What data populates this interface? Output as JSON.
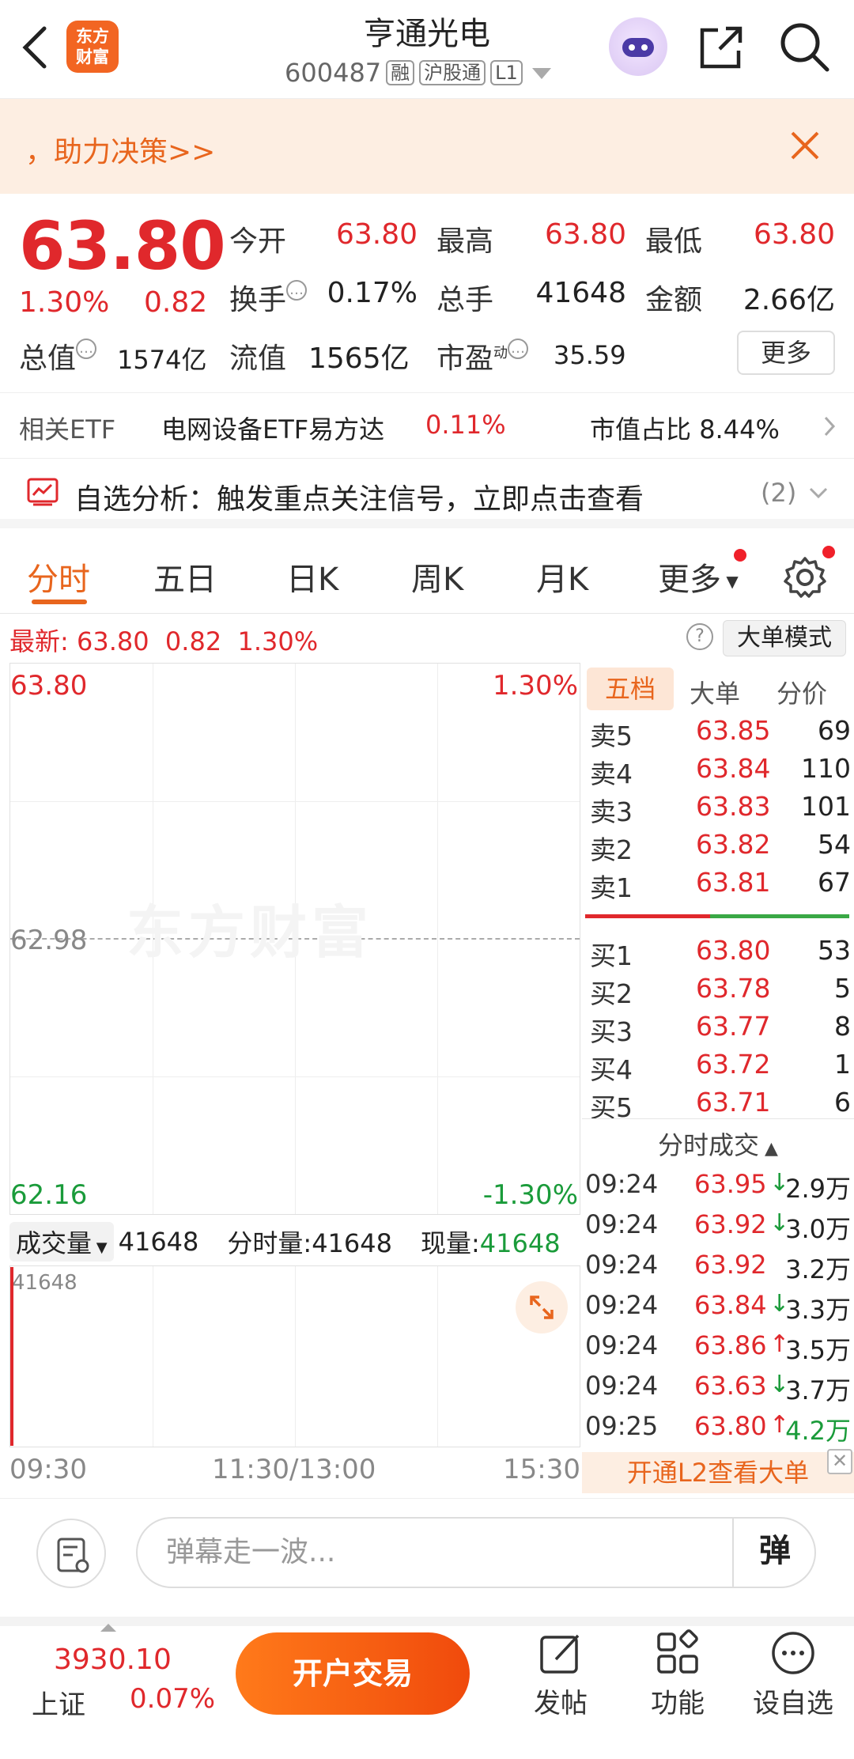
{
  "header": {
    "title": "亨通光电",
    "code": "600487",
    "tags": [
      "融",
      "沪股通",
      "L1"
    ],
    "logo_text_line1": "东方",
    "logo_text_line2": "财富"
  },
  "banner": {
    "text": "，助力决策>>"
  },
  "quote": {
    "price": "63.80",
    "change_pct": "1.30%",
    "change": "0.82",
    "fields": {
      "open_label": "今开",
      "open": "63.80",
      "high_label": "最高",
      "high": "63.80",
      "low_label": "最低",
      "low": "63.80",
      "turnover_label": "换手",
      "turnover": "0.17%",
      "volume_label": "总手",
      "volume": "41648",
      "amount_label": "金额",
      "amount": "2.66亿",
      "mktcap_label": "总值",
      "mktcap": "1574亿",
      "float_label": "流值",
      "float": "1565亿",
      "pe_label": "市盈",
      "pe_sup": "动",
      "pe": "35.59"
    },
    "more_label": "更多"
  },
  "etf": {
    "label": "相关ETF",
    "name": "电网设备ETF易方达",
    "pct": "0.11%",
    "ratio_label": "市值占比",
    "ratio": "8.44%"
  },
  "analysis": {
    "text": "自选分析：触发重点关注信号，立即点击查看",
    "count": "(2)"
  },
  "tabs": [
    "分时",
    "五日",
    "日K",
    "周K",
    "月K",
    "更多"
  ],
  "latest": {
    "label": "最新:",
    "price": "63.80",
    "change": "0.82",
    "pct": "1.30%",
    "mode_label": "大单模式"
  },
  "chart": {
    "top_price": "63.80",
    "top_pct": "1.30%",
    "mid_price": "62.98",
    "bottom_price": "62.16",
    "bottom_pct": "-1.30%",
    "watermark": "东方财富",
    "time_labels": [
      "09:30",
      "11:30/13:00",
      "15:30"
    ]
  },
  "volume": {
    "select_label": "成交量",
    "total": "41648",
    "fs_label": "分时量:",
    "fs": "41648",
    "now_label": "现量:",
    "now": "41648",
    "max_label": "41648"
  },
  "orderbook": {
    "tabs": [
      "五档",
      "大单",
      "分价"
    ],
    "asks": [
      {
        "label": "卖5",
        "price": "63.85",
        "vol": "69"
      },
      {
        "label": "卖4",
        "price": "63.84",
        "vol": "110"
      },
      {
        "label": "卖3",
        "price": "63.83",
        "vol": "101"
      },
      {
        "label": "卖2",
        "price": "63.82",
        "vol": "54"
      },
      {
        "label": "卖1",
        "price": "63.81",
        "vol": "67"
      }
    ],
    "bids": [
      {
        "label": "买1",
        "price": "63.80",
        "vol": "53"
      },
      {
        "label": "买2",
        "price": "63.78",
        "vol": "5"
      },
      {
        "label": "买3",
        "price": "63.77",
        "vol": "8"
      },
      {
        "label": "买4",
        "price": "63.72",
        "vol": "1"
      },
      {
        "label": "买5",
        "price": "63.71",
        "vol": "6"
      }
    ],
    "trades_title": "分时成交",
    "trades": [
      {
        "time": "09:24",
        "price": "63.95",
        "arrow": "↓",
        "vol": "2.9万",
        "dir": "down"
      },
      {
        "time": "09:24",
        "price": "63.92",
        "arrow": "↓",
        "vol": "3.0万",
        "dir": "down"
      },
      {
        "time": "09:24",
        "price": "63.92",
        "arrow": "",
        "vol": "3.2万",
        "dir": "none"
      },
      {
        "time": "09:24",
        "price": "63.84",
        "arrow": "↓",
        "vol": "3.3万",
        "dir": "down"
      },
      {
        "time": "09:24",
        "price": "63.86",
        "arrow": "↑",
        "vol": "3.5万",
        "dir": "up"
      },
      {
        "time": "09:24",
        "price": "63.63",
        "arrow": "↓",
        "vol": "3.7万",
        "dir": "down"
      },
      {
        "time": "09:25",
        "price": "63.80",
        "arrow": "↑",
        "vol": "4.2万",
        "dir": "up"
      }
    ],
    "l2_label": "开通L2查看大单"
  },
  "danmaku": {
    "placeholder": "弹幕走一波...",
    "send_label": "弹"
  },
  "bottom": {
    "index_value": "3930.10",
    "index_name": "上证",
    "index_pct": "0.07%",
    "trade_label": "开户交易",
    "post_label": "发帖",
    "func_label": "功能",
    "watch_label": "设自选"
  },
  "colors": {
    "up": "#e0282c",
    "down": "#1a9b3a",
    "accent": "#e8651d"
  }
}
